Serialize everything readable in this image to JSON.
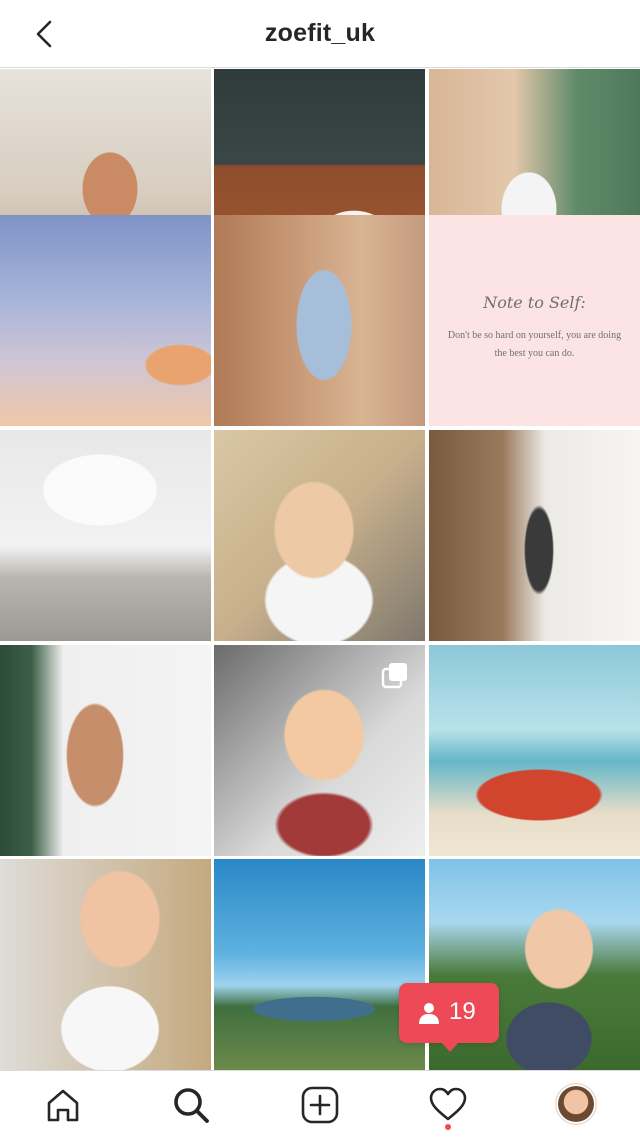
{
  "header": {
    "title": "zoefit_uk",
    "back_icon": "chevron-left-icon"
  },
  "grid": {
    "tiles": [
      {
        "name": "post-1"
      },
      {
        "name": "post-2"
      },
      {
        "name": "post-3"
      },
      {
        "name": "post-4"
      },
      {
        "name": "post-5"
      },
      {
        "name": "post-6",
        "note_title": "Note to Self:",
        "note_text": "Don't be so hard on yourself, you are doing the best you can do."
      },
      {
        "name": "post-7"
      },
      {
        "name": "post-8"
      },
      {
        "name": "post-9"
      },
      {
        "name": "post-10"
      },
      {
        "name": "post-11",
        "badge": "multiple-photos-icon"
      },
      {
        "name": "post-12"
      },
      {
        "name": "post-13"
      },
      {
        "name": "post-14"
      },
      {
        "name": "post-15"
      }
    ]
  },
  "notification": {
    "icon": "person-icon",
    "count": "19",
    "color": "#ed4956"
  },
  "tabbar": {
    "items": [
      "home-icon",
      "search-icon",
      "add-post-icon",
      "heart-icon",
      "profile-avatar"
    ]
  }
}
